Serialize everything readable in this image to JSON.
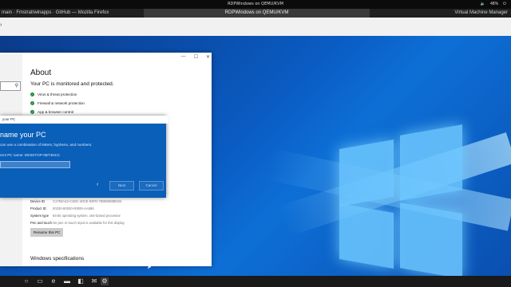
{
  "topbar": {
    "title": "RDPWindows on QEMU/KVM",
    "battery": "48%"
  },
  "tabs": [
    {
      "label": "main · Fmstrat/winapps · GitHub — Mozilla Firefox"
    },
    {
      "label": "RDPWindows on QEMU/KVM"
    },
    {
      "label": "Virtual Machine Manager"
    }
  ],
  "about": {
    "title": "About",
    "subtitle": "Your PC is monitored and protected.",
    "checks": [
      "Virus & threat protection",
      "Firewall & network protection",
      "App & browser control"
    ],
    "specs": [
      {
        "key": "Device ID",
        "value": "C1793A42-C4DC-40CE-93FD-750E8E885024"
      },
      {
        "key": "Product ID",
        "value": "00330-80000-00000-AA586"
      },
      {
        "key": "System type",
        "value": "64-bit operating system, x64-based processor"
      },
      {
        "key": "Pen and touch",
        "value": "No pen or touch input is available for this display"
      }
    ],
    "rename_button": "Rename this PC",
    "windows_specs": "Windows specifications"
  },
  "dialog": {
    "bar": "your PC",
    "title": "name your PC",
    "text": "can use a combination of letters, hyphens, and numbers.",
    "current": "rent PC name: DESKTOP-0BT4NCC",
    "next": "Next",
    "cancel": "Cancel"
  },
  "colors": {
    "dialog_bg": "#0a5fb8",
    "desktop_bg": "#0a5bc2"
  }
}
